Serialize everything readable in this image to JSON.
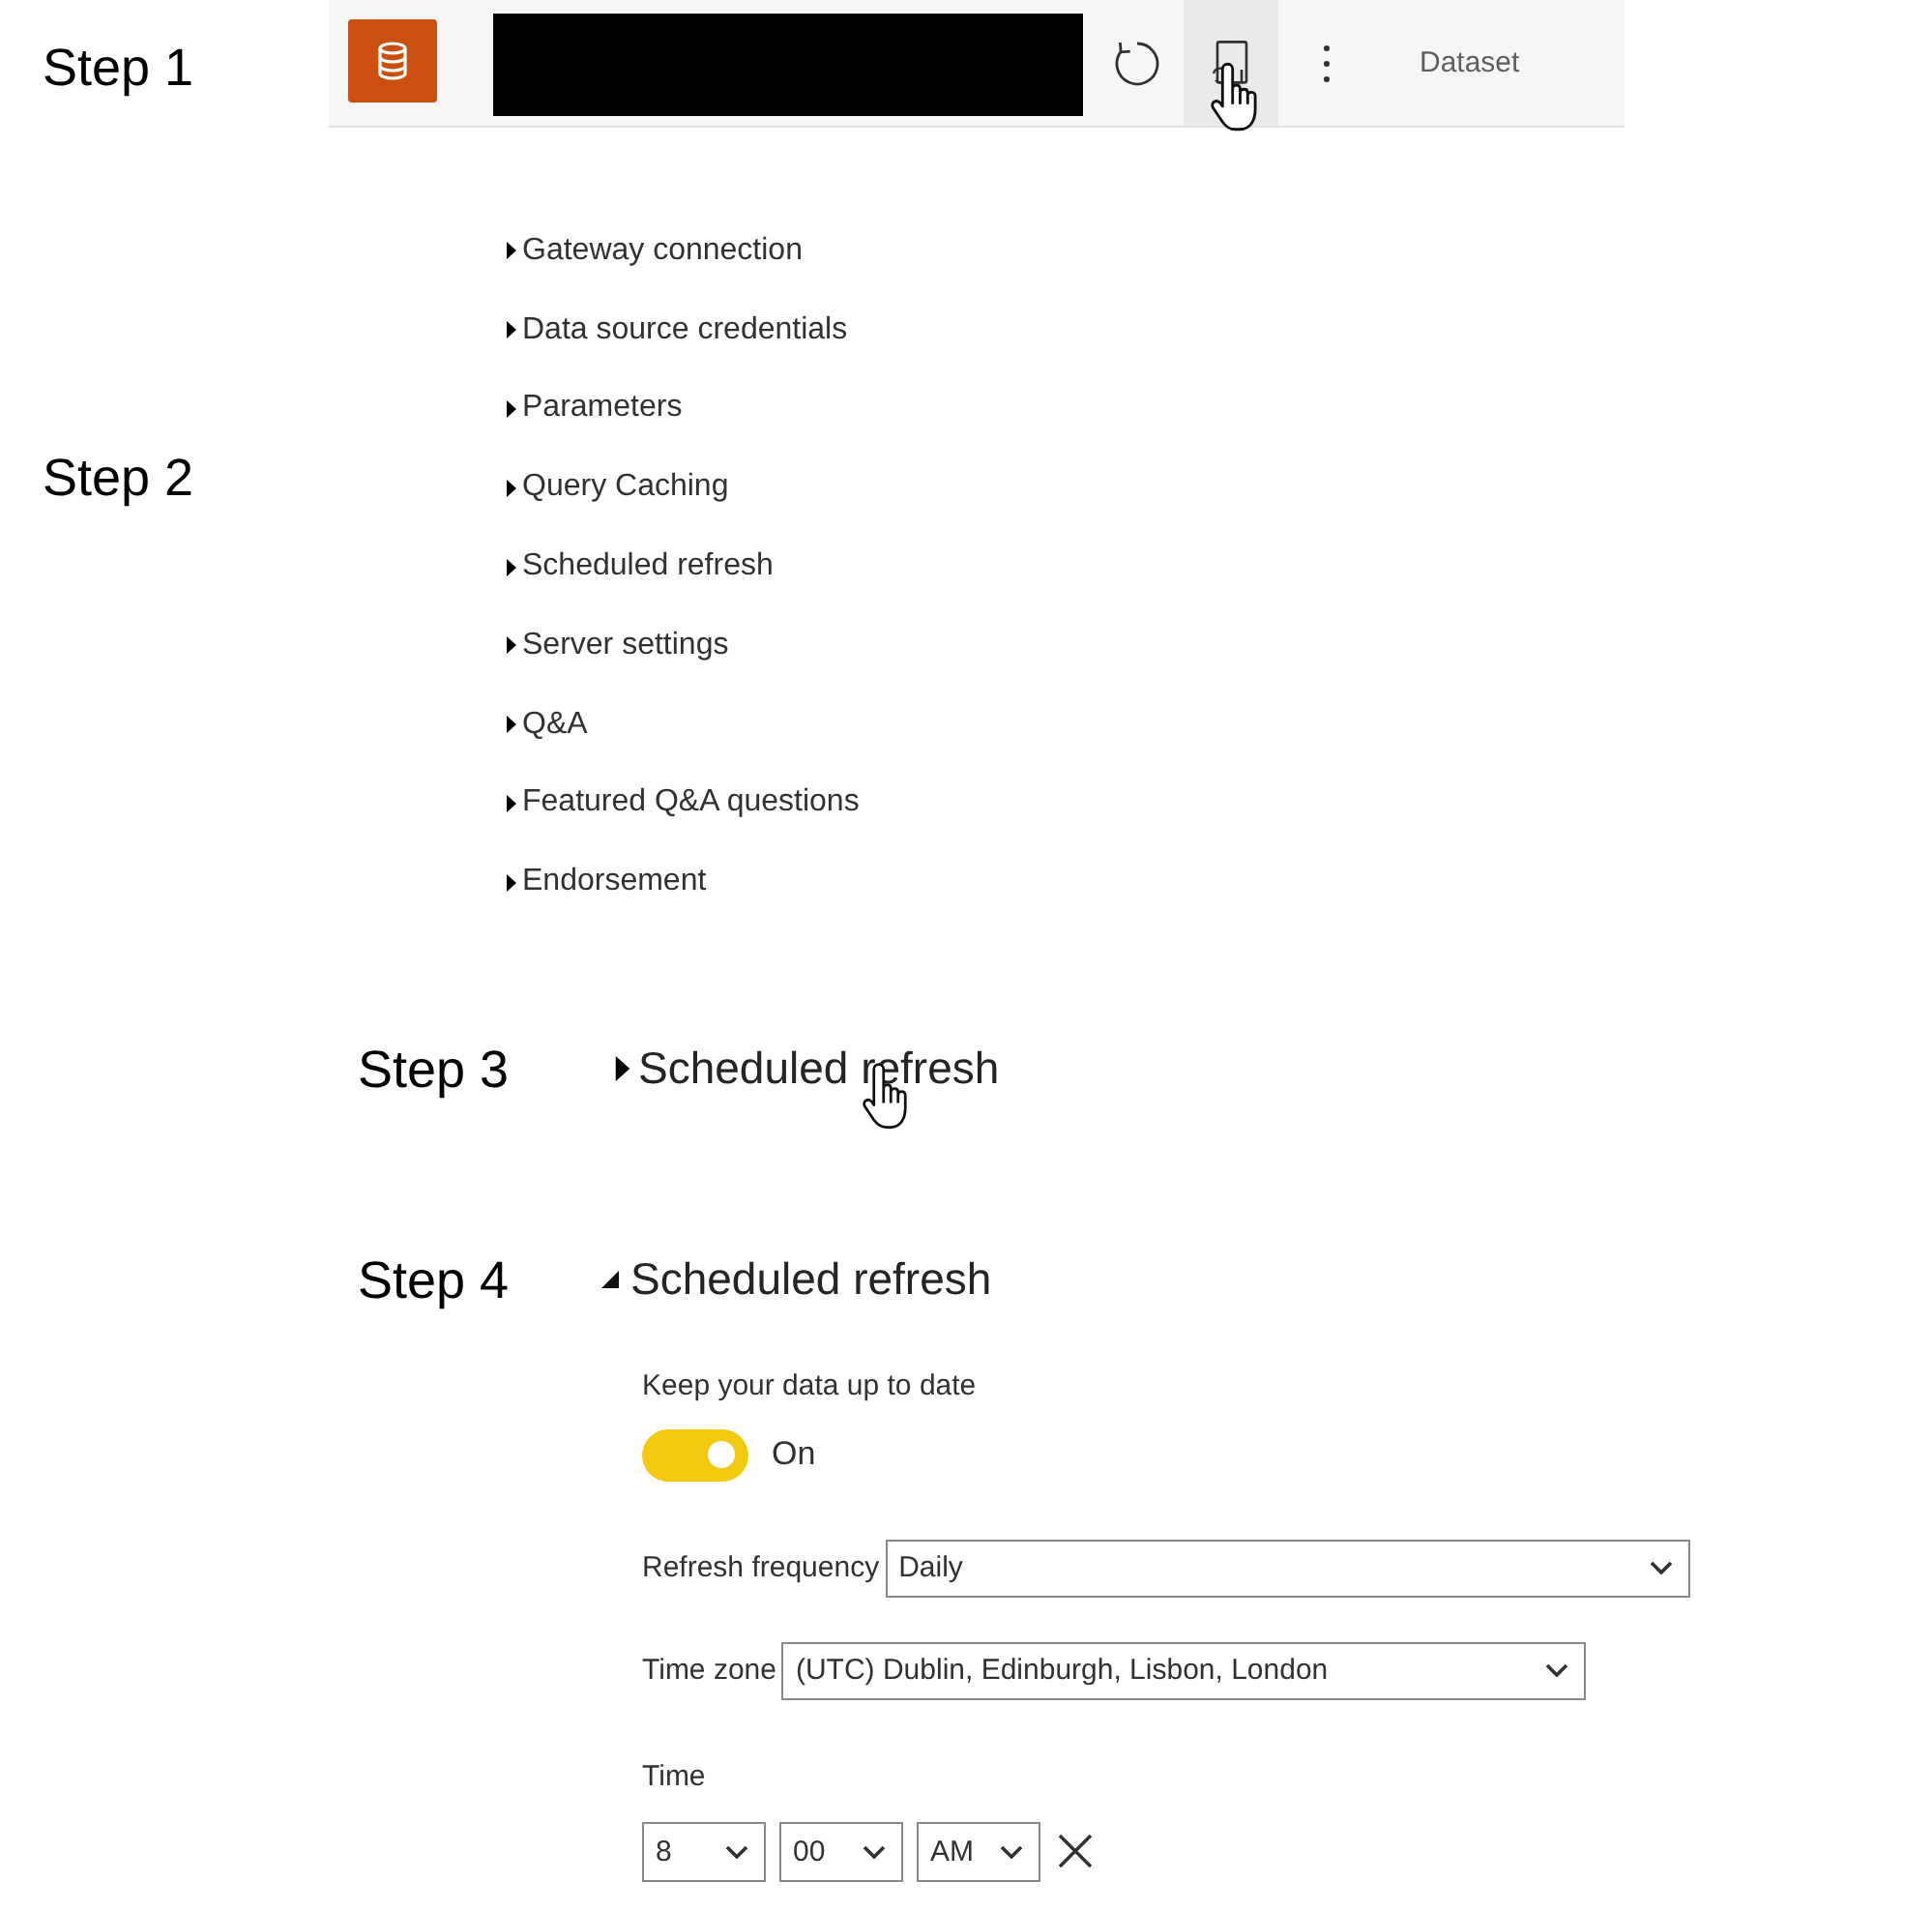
{
  "step_1": {
    "label": "Step 1",
    "toolbar": {
      "buttons": [
        {
          "kind": "refresh",
          "hovered": false
        },
        {
          "kind": "page_refresh",
          "hovered": true
        },
        {
          "kind": "more",
          "hovered": false
        }
      ],
      "item_type": "Dataset"
    }
  },
  "step_2": {
    "label": "Step 2",
    "sections": [
      {
        "title": "Gateway connection",
        "expanded": false
      },
      {
        "title": "Data source credentials",
        "expanded": false
      },
      {
        "title": "Parameters",
        "expanded": false
      },
      {
        "title": "Query Caching",
        "expanded": false
      },
      {
        "title": "Scheduled refresh",
        "expanded": false
      },
      {
        "title": "Server settings",
        "expanded": false
      },
      {
        "title": "Q&A",
        "expanded": false
      },
      {
        "title": "Featured Q&A questions",
        "expanded": false
      },
      {
        "title": "Endorsement",
        "expanded": false
      }
    ]
  },
  "step_3": {
    "label": "Step 3",
    "section": {
      "title": "Scheduled refresh",
      "expanded": false,
      "hovered": true
    }
  },
  "step_4": {
    "label": "Step 4",
    "section": {
      "title": "Scheduled refresh",
      "expanded": true,
      "settings": {
        "keep_up_to_date": {
          "label": "Keep your data up to date",
          "toggle": {
            "on": true,
            "text": "On"
          }
        },
        "refresh_frequency": {
          "label": "Refresh frequency",
          "value": "Daily"
        },
        "time_zone": {
          "label": "Time zone",
          "value": "(UTC) Dublin, Edinburgh, Lisbon, London"
        },
        "time": {
          "label": "Time",
          "slots": [
            {
              "hour": "8",
              "minute": "00",
              "period": "AM"
            }
          ]
        }
      }
    }
  }
}
